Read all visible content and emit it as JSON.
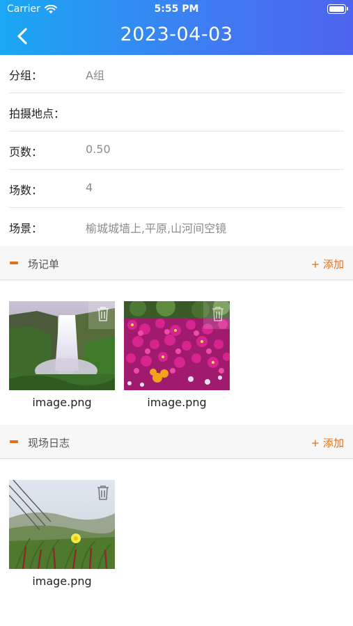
{
  "status_bar": {
    "carrier": "Carrier",
    "time": "5:55 PM"
  },
  "nav": {
    "title": "2023-04-03"
  },
  "info": {
    "rows": [
      {
        "label": "分组：",
        "value": "A组"
      },
      {
        "label": "拍摄地点：",
        "value": ""
      },
      {
        "label": "页数：",
        "value": "0.50"
      },
      {
        "label": "场数：",
        "value": "4"
      },
      {
        "label": "场景：",
        "value": "榆城城墙上,平原,山河间空镜"
      }
    ]
  },
  "sections": [
    {
      "title": "场记单",
      "add_label": "+ 添加",
      "images": [
        {
          "caption": "image.png",
          "subject": "waterfall"
        },
        {
          "caption": "image.png",
          "subject": "flowers"
        }
      ]
    },
    {
      "title": "现场日志",
      "add_label": "+ 添加",
      "images": [
        {
          "caption": "image.png",
          "subject": "grass-and-flower"
        }
      ]
    }
  ],
  "colors": {
    "accent": "#e0701a",
    "header_gradient_start": "#1aa8f3",
    "header_gradient_end": "#4d64ee"
  }
}
